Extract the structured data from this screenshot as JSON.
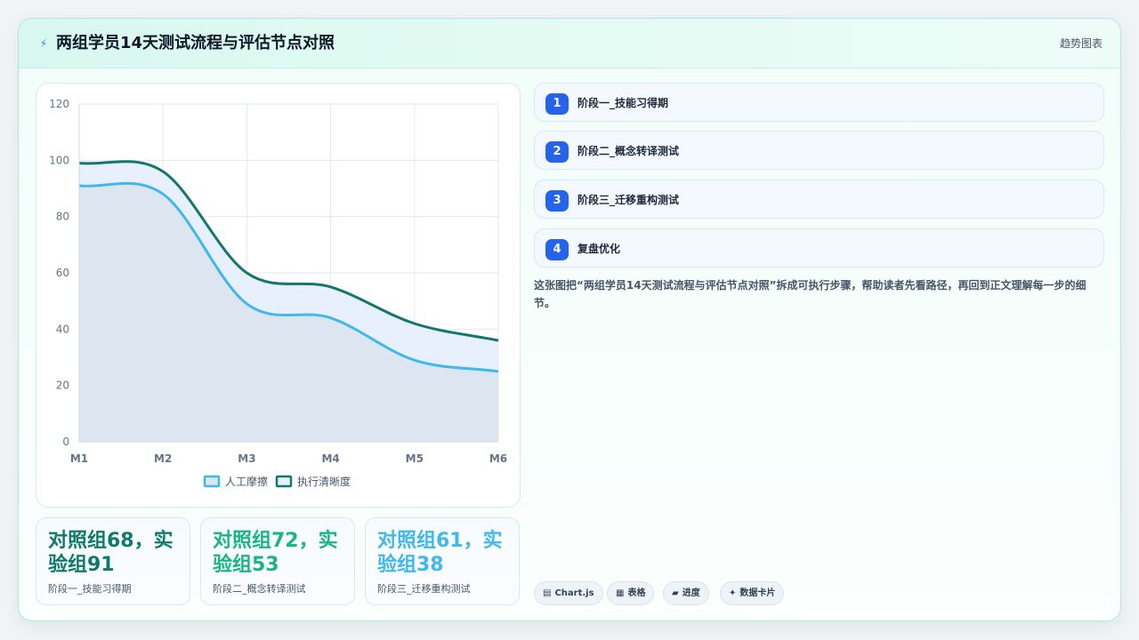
{
  "header": {
    "icon": "lightning-icon",
    "title": "两组学员14天测试流程与评估节点对照",
    "tag": "趋势图表"
  },
  "chart_data": {
    "type": "area",
    "categories": [
      "M1",
      "M2",
      "M3",
      "M4",
      "M5",
      "M6"
    ],
    "ylim": [
      0,
      120
    ],
    "yticks": [
      0,
      20,
      40,
      60,
      80,
      100,
      120
    ],
    "grid": true,
    "legend_position": "bottom",
    "series": [
      {
        "name": "人工摩擦",
        "values": [
          91,
          88,
          49,
          44,
          29,
          25
        ],
        "color": "#3fb8ec",
        "fill": "#dde6f0"
      },
      {
        "name": "执行清晰度",
        "values": [
          99,
          96,
          60,
          55,
          42,
          36
        ],
        "color": "#13776b",
        "fill": "#e8f0fd"
      }
    ]
  },
  "stats": [
    {
      "value": "对照组68，实验组91",
      "label": "阶段一_技能习得期",
      "color": "#0f7a6c"
    },
    {
      "value": "对照组72，实验组53",
      "label": "阶段二_概念转译测试",
      "color": "#1bb585"
    },
    {
      "value": "对照组61，实验组38",
      "label": "阶段三_迁移重构测试",
      "color": "#3fb8ec"
    }
  ],
  "steps": [
    {
      "num": "1",
      "label": "阶段一_技能习得期"
    },
    {
      "num": "2",
      "label": "阶段二_概念转译测试"
    },
    {
      "num": "3",
      "label": "阶段三_迁移重构测试"
    },
    {
      "num": "4",
      "label": "复盘优化"
    }
  ],
  "description": "这张图把“两组学员14天测试流程与评估节点对照”拆成可执行步骤，帮助读者先看路径，再回到正文理解每一步的细节。",
  "chips": [
    {
      "icon": "table-icon",
      "glyph": "▤",
      "label": "Chart.js"
    },
    {
      "icon": "grid-icon",
      "glyph": "▦",
      "label": "表格"
    },
    {
      "icon": "progress-icon",
      "glyph": "▰",
      "label": "进度"
    },
    {
      "icon": "sparkle-icon",
      "glyph": "✦",
      "label": "数据卡片"
    }
  ]
}
